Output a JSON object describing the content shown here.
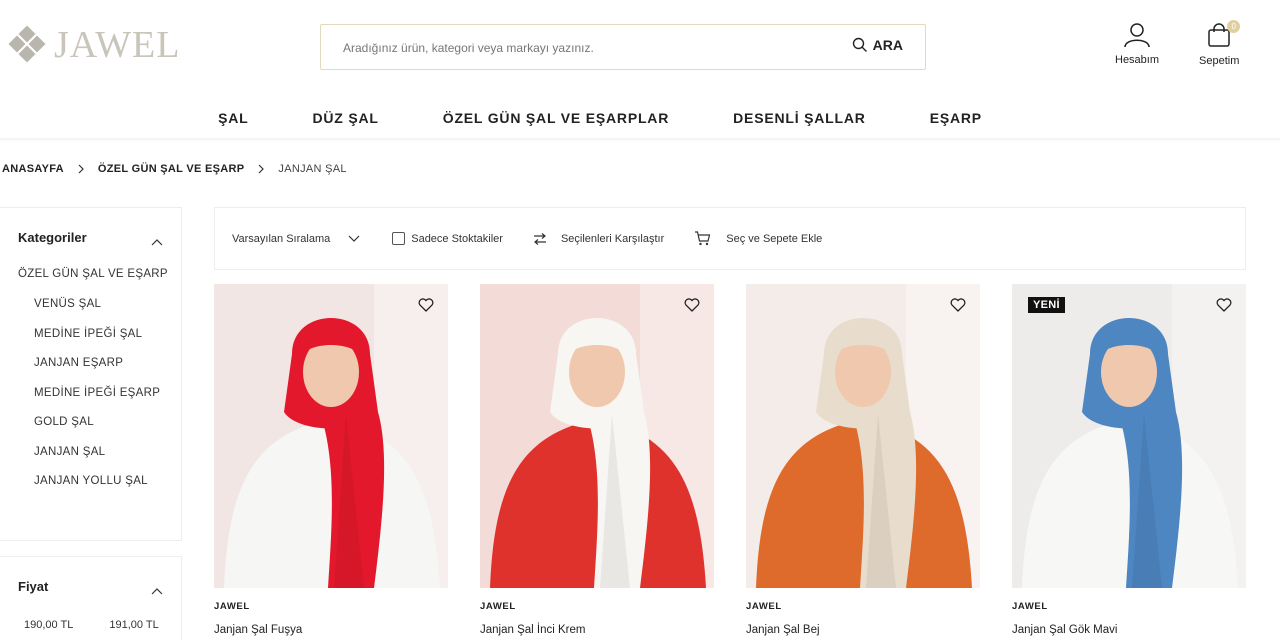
{
  "header": {
    "logo_text": "JAWEL",
    "search_placeholder": "Aradığınız ürün, kategori veya markayı yazınız.",
    "search_button": "ARA",
    "account_label": "Hesabım",
    "cart_label": "Sepetim",
    "cart_count": "0"
  },
  "nav": {
    "items": [
      "ŞAL",
      "DÜZ ŞAL",
      "ÖZEL GÜN ŞAL VE EŞARPLAR",
      "DESENLİ ŞALLAR",
      "EŞARP"
    ]
  },
  "breadcrumb": [
    "ANASAYFA",
    "ÖZEL GÜN ŞAL VE EŞARP",
    "JANJAN ŞAL"
  ],
  "sidebar": {
    "categories_title": "Kategoriler",
    "parent_category": "ÖZEL GÜN ŞAL VE EŞARP",
    "categories": [
      "VENÜS ŞAL",
      "MEDİNE İPEĞİ ŞAL",
      "JANJAN EŞARP",
      "MEDİNE İPEĞİ EŞARP",
      "GOLD ŞAL",
      "JANJAN ŞAL",
      "JANJAN YOLLU ŞAL"
    ],
    "price_title": "Fiyat",
    "price_min": "190,00 TL",
    "price_max": "191,00 TL"
  },
  "toolbar": {
    "sort_label": "Varsayılan Sıralama",
    "in_stock_label": "Sadece Stoktakiler",
    "in_stock_checked": false,
    "compare_label": "Seçilenleri Karşılaştır",
    "add_to_cart_label": "Seç ve Sepete Ekle"
  },
  "products": [
    {
      "brand": "JAWEL",
      "name": "Janjan Şal Fuşya",
      "badge": "",
      "scarf_color": "#e4182c",
      "outfit_color": "#f6f6f4",
      "bg_color": "#f1e6e3"
    },
    {
      "brand": "JAWEL",
      "name": "Janjan Şal İnci Krem",
      "badge": "",
      "scarf_color": "#f7f6f2",
      "outfit_color": "#e0322c",
      "bg_color": "#f3dcd8"
    },
    {
      "brand": "JAWEL",
      "name": "Janjan Şal Bej",
      "badge": "",
      "scarf_color": "#e8dccd",
      "outfit_color": "#de6a2c",
      "bg_color": "#f4ece8"
    },
    {
      "brand": "JAWEL",
      "name": "Janjan Şal Gök Mavi",
      "badge": "YENİ",
      "scarf_color": "#4d86c1",
      "outfit_color": "#f7f7f5",
      "bg_color": "#eeecea"
    }
  ],
  "colors": {
    "accent_gold": "#e2cf9e",
    "search_border": "#e4d9bf",
    "skin": "#efc8ad"
  }
}
